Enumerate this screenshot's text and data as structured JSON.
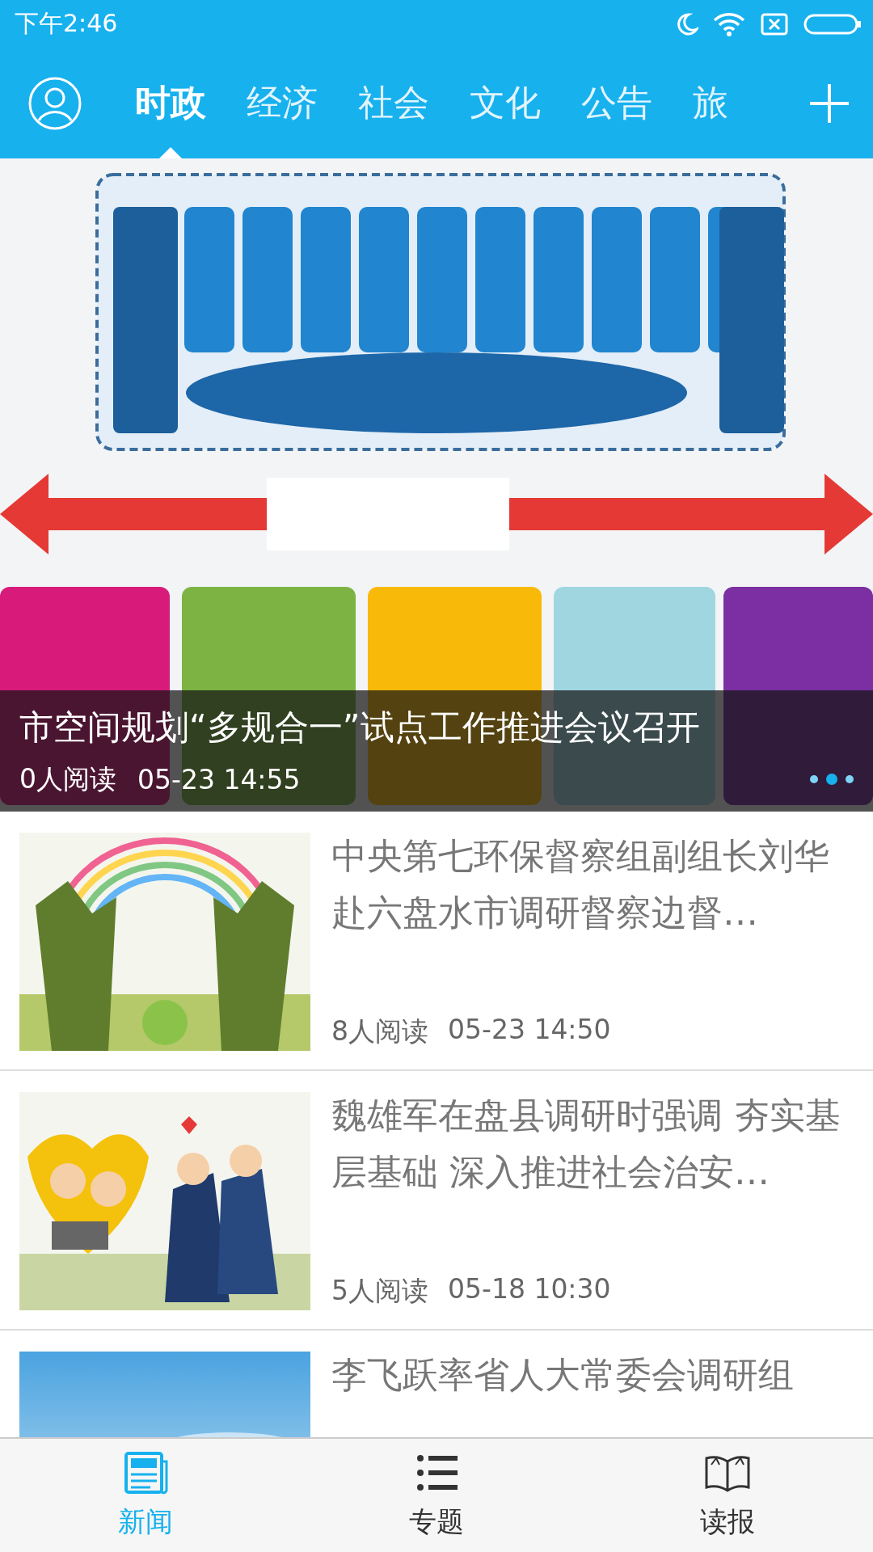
{
  "status_bar": {
    "time": "下午2:46"
  },
  "tabs": [
    {
      "label": "时政",
      "selected": true
    },
    {
      "label": "经济",
      "selected": false
    },
    {
      "label": "社会",
      "selected": false
    },
    {
      "label": "文化",
      "selected": false
    },
    {
      "label": "公告",
      "selected": false
    },
    {
      "label": "旅",
      "selected": false
    }
  ],
  "banner": {
    "title": "市空间规划“多规合一”试点工作推进会议召开",
    "reads": "0人阅读",
    "time": "05-23 14:55",
    "dots": [
      {
        "selected": false
      },
      {
        "selected": true
      },
      {
        "selected": false
      }
    ]
  },
  "news": [
    {
      "title": "中央第七环保督察组副组长刘华赴六盘水市调研督察边督…",
      "reads": "8人阅读",
      "time": "05-23 14:50"
    },
    {
      "title": "魏雄军在盘县调研时强调  夯实基层基础 深入推进社会治安…",
      "reads": "5人阅读",
      "time": "05-18 10:30"
    },
    {
      "title": "李飞跃率省人大常委会调研组"
    }
  ],
  "bottom_nav": [
    {
      "label": "新闻",
      "selected": true,
      "kind": "news"
    },
    {
      "label": "专题",
      "selected": false,
      "kind": "list"
    },
    {
      "label": "读报",
      "selected": false,
      "kind": "book"
    }
  ]
}
